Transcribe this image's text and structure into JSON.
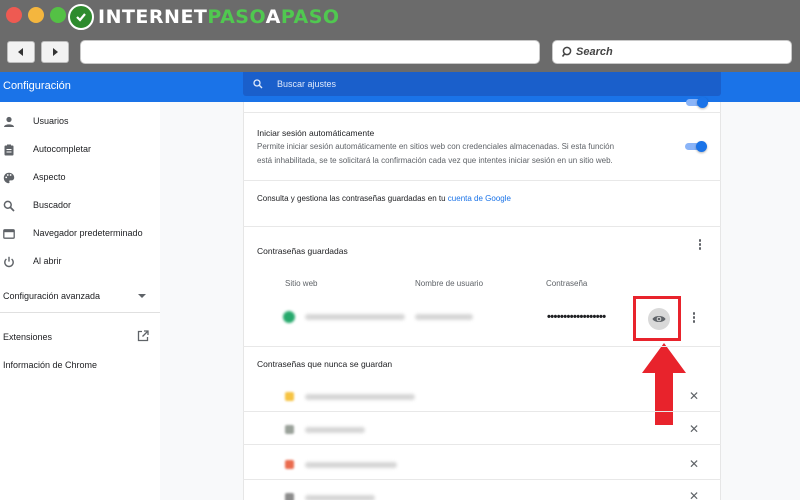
{
  "browser": {
    "brand_part1": "INTERNET",
    "brand_part2": "PASO",
    "brand_part3": "A",
    "brand_part4": "PASO",
    "back_icon": "back-arrow-icon",
    "forward_icon": "forward-arrow-icon",
    "search_placeholder": "Search"
  },
  "header": {
    "title": "Configuración",
    "search_placeholder": "Buscar ajustes"
  },
  "sidebar": {
    "items": [
      {
        "label": "Usuarios",
        "icon": "person-icon"
      },
      {
        "label": "Autocompletar",
        "icon": "clipboard-icon"
      },
      {
        "label": "Aspecto",
        "icon": "palette-icon"
      },
      {
        "label": "Buscador",
        "icon": "search-icon"
      },
      {
        "label": "Navegador predeterminado",
        "icon": "browser-icon"
      },
      {
        "label": "Al abrir",
        "icon": "power-icon"
      }
    ],
    "advanced_label": "Configuración avanzada",
    "extensions_label": "Extensiones",
    "about_label": "Información de Chrome"
  },
  "content": {
    "autologin_title": "Iniciar sesión automáticamente",
    "autologin_desc_line1": "Permite iniciar sesión automáticamente en sitios web con credenciales almacenadas. Si esta función",
    "autologin_desc_line2": "está inhabilitada, se te solicitará la confirmación cada vez que intentes iniciar sesión en un sitio web.",
    "autologin_enabled": true,
    "manage_text": "Consulta y gestiona las contraseñas guardadas en tu ",
    "manage_link": "cuenta de Google",
    "saved_title": "Contraseñas guardadas",
    "col_site": "Sitio web",
    "col_user": "Nombre de usuario",
    "col_password": "Contraseña",
    "password_mask": "••••••••••••••••••",
    "never_saved_title": "Contraseñas que nunca se guardan"
  },
  "colors": {
    "accent": "#1a73e8",
    "highlight": "#e8232c"
  }
}
